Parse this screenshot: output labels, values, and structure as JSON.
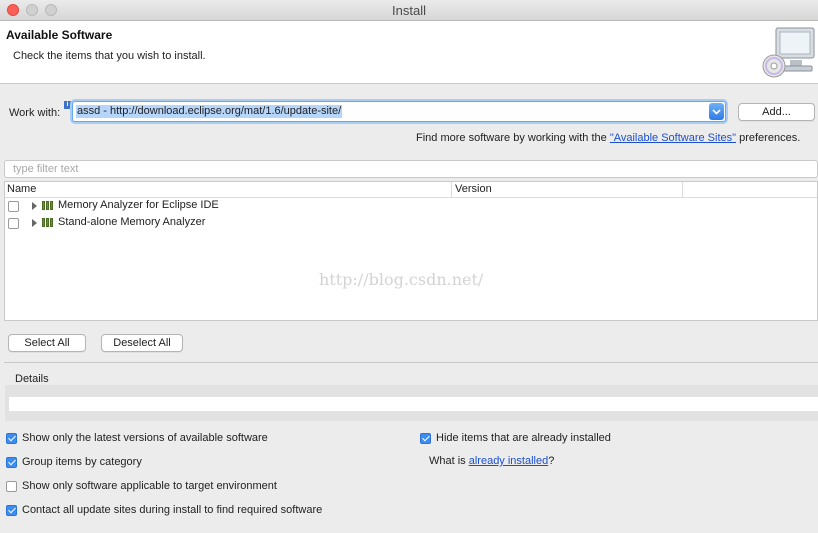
{
  "window": {
    "title": "Install"
  },
  "banner": {
    "title": "Available Software",
    "subtitle": "Check the items that you wish to install.",
    "icon": "computer-cd-icon"
  },
  "work_with": {
    "label": "Work with:",
    "value": "assd - http://download.eclipse.org/mat/1.6/update-site/",
    "add_button": "Add..."
  },
  "more_software": {
    "prefix": "Find more software by working with the ",
    "link": "\"Available Software Sites\"",
    "suffix": " preferences."
  },
  "filter": {
    "placeholder": "type filter text"
  },
  "tree": {
    "columns": [
      "Name",
      "Version"
    ],
    "rows": [
      {
        "label": "Memory Analyzer for Eclipse IDE",
        "version": "",
        "checked": false
      },
      {
        "label": "Stand-alone Memory Analyzer",
        "version": "",
        "checked": false
      }
    ],
    "watermark": "http://blog.csdn.net/"
  },
  "buttons": {
    "select_all": "Select All",
    "deselect_all": "Deselect All"
  },
  "details": {
    "label": "Details",
    "text": ""
  },
  "options": {
    "latest_versions": {
      "label": "Show only the latest versions of available software",
      "checked": true
    },
    "group_by_category": {
      "label": "Group items by category",
      "checked": true
    },
    "target_env": {
      "label": "Show only software applicable to target environment",
      "checked": false
    },
    "contact_sites": {
      "label": "Contact all update sites during install to find required software",
      "checked": true
    },
    "hide_installed": {
      "label": "Hide items that are already installed",
      "checked": true
    }
  },
  "what_is": {
    "prefix": "What is ",
    "link": "already installed",
    "suffix": "?"
  },
  "colors": {
    "accent": "#3b8ef0",
    "link": "#1b4fd0",
    "selection": "#b5d5fb"
  }
}
